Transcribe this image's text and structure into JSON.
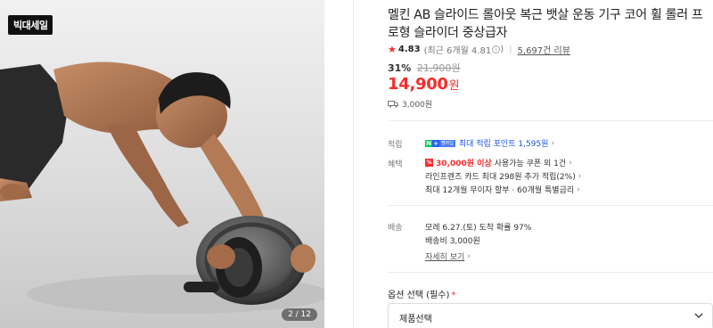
{
  "image": {
    "badge": "빅대세일",
    "counter": "2 / 12"
  },
  "product": {
    "title": "멜킨 AB 슬라이드 롤아웃 복근 뱃살 운동 기구 코어 휠 롤러 프로형 슬라이더 중상급자",
    "rating": "4.83",
    "recent_rating": "(최근 6개월 4.81",
    "recent_rating_close": ")",
    "review_count": "5,697건 리뷰",
    "discount_pct": "31%",
    "original_price": "21,900원",
    "price": "14,900",
    "price_unit": "원",
    "shipping_fee": "3,000원"
  },
  "points": {
    "label": "적립",
    "badge_n": "N",
    "badge_plus": "+",
    "badge_member": "멤버십",
    "text": "최대 적립 포인트 1,595원"
  },
  "benefits": {
    "label": "혜택",
    "badge": "%",
    "line1_highlight": "30,000원 이상",
    "line1_rest": "사용가능 쿠폰 외 1건",
    "line2": "라인프렌즈 카드 최대 298원 추가 적립(2%)",
    "line3": "최대 12개월 무이자 할부 · 60개월 특별금리"
  },
  "delivery": {
    "label": "배송",
    "line1": "모레 6.27.(토) 도착 확률 97%",
    "line2": "배송비 3,000원",
    "detail_link": "자세히 보기"
  },
  "option": {
    "label": "옵션 선택 (필수)",
    "required_mark": "*",
    "select_value": "제품선택"
  },
  "colors": {
    "accent_red": "#f52d2d",
    "naver_green": "#03c75a",
    "link_blue": "#1a55e8"
  }
}
